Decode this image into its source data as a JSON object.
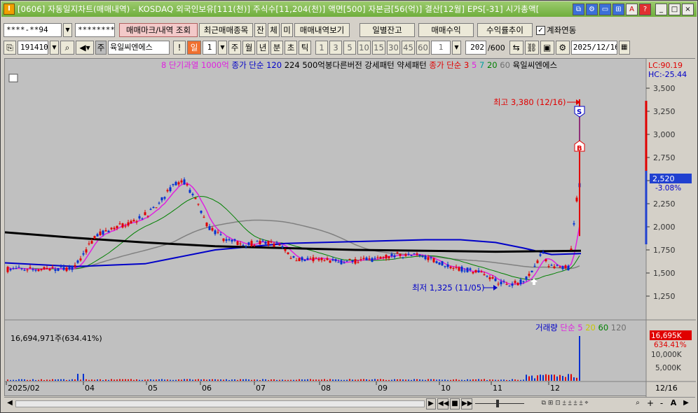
{
  "window": {
    "title": "[0606] 자동일지차트(매매내역) - KOSDAQ 외국인보유[111(천)] 주식수[11,204(천)] 액면[500] 자본금[56(억)] 결산[12월] EPS[-31] 시가총액[",
    "app_icon": "I",
    "title_buttons": [
      "⧉",
      "⚙",
      "▭",
      "⊞",
      "A",
      "?"
    ],
    "controls": [
      "_",
      "□",
      "×"
    ]
  },
  "toolbar1": {
    "account": "****-**94",
    "password": "********",
    "btn_trade_mark": "매매마크/내역 조회",
    "btn_recent": "최근매매종목",
    "btn_jan": "잔",
    "btn_che": "체",
    "btn_mi": "미",
    "btn_view": "매매내역보기",
    "btn_daily_balance": "일별잔고",
    "btn_profit": "매매수익",
    "btn_return": "수익률추이",
    "chk_account_link": "계좌연동",
    "chk_account_link_checked": true
  },
  "toolbar2": {
    "code": "191410",
    "stock_badge": "주",
    "stock_name": "육일씨엔에스",
    "period_day": "일",
    "period_num": "1",
    "periods": [
      "주",
      "월",
      "년",
      "분",
      "초",
      "틱"
    ],
    "intervals": [
      "1",
      "3",
      "5",
      "10",
      "15",
      "30",
      "45",
      "60"
    ],
    "interval_sel": "1",
    "count": "202",
    "count_max": "/600",
    "date": "2025/12/16"
  },
  "legend": {
    "items": [
      {
        "text": "8",
        "color": "#e020e0"
      },
      {
        "text": "단기과열",
        "color": "#e020e0"
      },
      {
        "text": "1000억",
        "color": "#e020e0"
      },
      {
        "text": "종가 단순 120",
        "color": "#0000c8"
      },
      {
        "text": "224",
        "color": "#000000"
      },
      {
        "text": "500억봉다른버전 강세패턴",
        "color": "#000000"
      },
      {
        "text": "약세패턴",
        "color": "#000000"
      },
      {
        "text": "종가 단순 3",
        "color": "#e00000"
      },
      {
        "text": "5",
        "color": "#e020e0"
      },
      {
        "text": "7",
        "color": "#00a0a0"
      },
      {
        "text": "20",
        "color": "#008000"
      },
      {
        "text": "60",
        "color": "#707070"
      },
      {
        "text": "육일씨엔에스",
        "color": "#000000"
      }
    ],
    "lc": "LC:90.19",
    "hc": "HC:-25.44"
  },
  "price_axis": {
    "ticks": [
      "3,500",
      "3,250",
      "3,000",
      "2,750",
      "2,500",
      "2,250",
      "2,000",
      "1,750",
      "1,500",
      "1,250"
    ],
    "current_price": "2,520",
    "current_change": "-3.08%"
  },
  "annotations": {
    "high": "최고 3,380 (12/16)",
    "low": "최저 1,325 (11/05)",
    "sell_mark": "S",
    "buy_mark": "B"
  },
  "volume": {
    "legend": [
      "거래량",
      "단순 5",
      "20",
      "60",
      "120"
    ],
    "legend_colors": [
      "#0000c8",
      "#e020e0",
      "#c8c800",
      "#008000",
      "#707070"
    ],
    "last_volume": "16,694,971주(634.41%)",
    "axis_ticks": [
      "10,000K",
      "5,000K"
    ],
    "current_volume": "16,695K",
    "current_pct": "634.41%"
  },
  "date_axis": {
    "labels": [
      "2025/02",
      "04",
      "05",
      "06",
      "07",
      "08",
      "09",
      "10",
      "11",
      "12"
    ],
    "right_label": "12/16"
  },
  "bottom_controls": [
    "◀",
    "▶",
    "◀◀",
    "■",
    "▶▶",
    "+",
    "-",
    "A",
    "▶"
  ],
  "chart_data": {
    "type": "candlestick",
    "ylim": [
      1150,
      3600
    ],
    "high": {
      "value": 3380,
      "date": "12/16"
    },
    "low": {
      "value": 1325,
      "date": "11/05"
    },
    "close": 2520
  }
}
